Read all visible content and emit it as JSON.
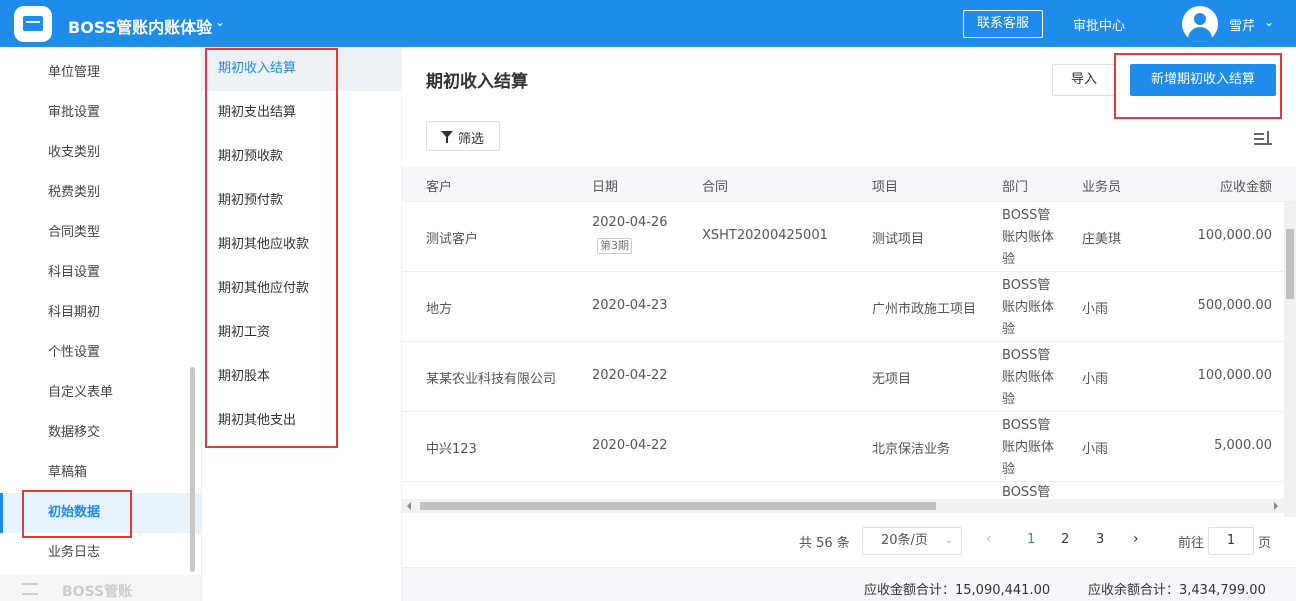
{
  "header": {
    "app_title": "BOSS管账内账体验",
    "service_button": "联系客服",
    "approval_center": "审批中心",
    "user_name": "雪芹"
  },
  "sidebar": {
    "items": [
      {
        "label": "单位管理"
      },
      {
        "label": "审批设置"
      },
      {
        "label": "收支类别"
      },
      {
        "label": "税费类别"
      },
      {
        "label": "合同类型"
      },
      {
        "label": "科目设置"
      },
      {
        "label": "科目期初"
      },
      {
        "label": "个性设置"
      },
      {
        "label": "自定义表单"
      },
      {
        "label": "数据移交"
      },
      {
        "label": "草稿箱"
      },
      {
        "label": "初始数据",
        "active": true
      },
      {
        "label": "业务日志"
      }
    ],
    "footer_label": "BOSS管账"
  },
  "submenu": {
    "items": [
      {
        "label": "期初收入结算",
        "active": true
      },
      {
        "label": "期初支出结算"
      },
      {
        "label": "期初预收款"
      },
      {
        "label": "期初预付款"
      },
      {
        "label": "期初其他应收款"
      },
      {
        "label": "期初其他应付款"
      },
      {
        "label": "期初工资"
      },
      {
        "label": "期初股本"
      },
      {
        "label": "期初其他支出"
      }
    ]
  },
  "main": {
    "title": "期初收入结算",
    "import_button": "导入",
    "new_button": "新增期初收入结算",
    "filter_button": "筛选",
    "columns": {
      "customer": "客户",
      "date": "日期",
      "contract": "合同",
      "project": "项目",
      "department": "部门",
      "salesperson": "业务员",
      "receivable": "应收金额"
    },
    "rows": [
      {
        "customer": "测试客户",
        "date": "2020-04-26",
        "badge": "第3期",
        "contract": "XSHT20200425001",
        "project": "测试项目",
        "department": "BOSS管账内账体验",
        "salesperson": "庄美琪",
        "receivable": "100,000.00"
      },
      {
        "customer": "地方",
        "date": "2020-04-23",
        "badge": "",
        "contract": "",
        "project": "广州市政施工项目",
        "department": "BOSS管账内账体验",
        "salesperson": "小雨",
        "receivable": "500,000.00"
      },
      {
        "customer": "某某农业科技有限公司",
        "date": "2020-04-22",
        "badge": "",
        "contract": "",
        "project": "无项目",
        "department": "BOSS管账内账体验",
        "salesperson": "小雨",
        "receivable": "100,000.00"
      },
      {
        "customer": "中兴123",
        "date": "2020-04-22",
        "badge": "",
        "contract": "",
        "project": "北京保洁业务",
        "department": "BOSS管账内账体验",
        "salesperson": "小雨",
        "receivable": "5,000.00"
      },
      {
        "customer": "",
        "date": "",
        "badge": "",
        "contract": "",
        "project": "",
        "department": "BOSS管",
        "salesperson": "",
        "receivable": ""
      }
    ],
    "pagination": {
      "total": "共 56 条",
      "page_size": "20条/页",
      "pages": [
        "1",
        "2",
        "3"
      ],
      "current": "1",
      "goto_label": "前往",
      "goto_value": "1",
      "page_label": "页"
    },
    "summary": {
      "receivable_total": "应收金额合计：15,090,441.00",
      "balance_total": "应收余额合计：3,434,799.00"
    }
  },
  "colors": {
    "primary": "#1f8ceb",
    "highlight": "#e53935"
  }
}
